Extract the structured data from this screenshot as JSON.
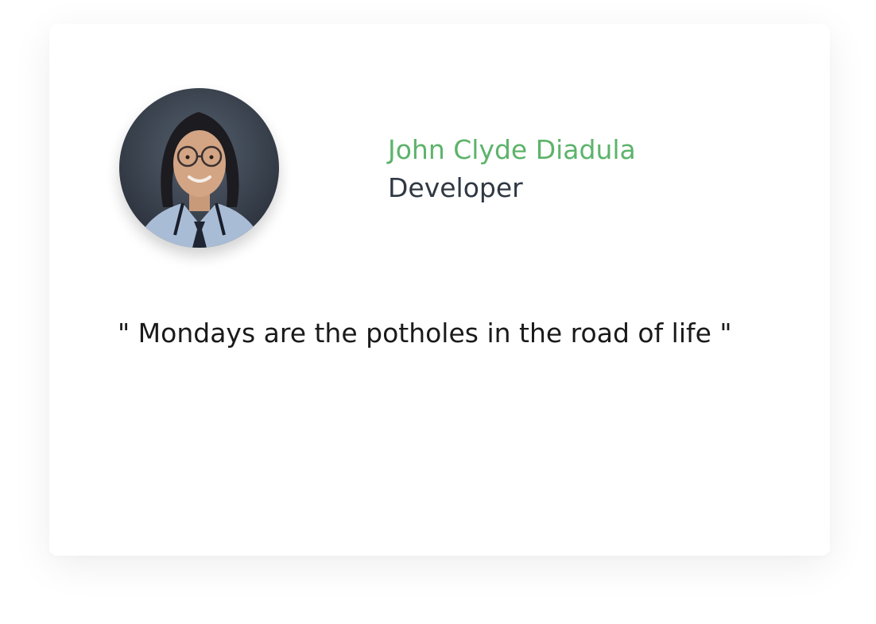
{
  "profile": {
    "name": "John Clyde Diadula",
    "role": "Developer",
    "avatar_icon": "avatar-photo"
  },
  "quote": {
    "text": "\" Mondays are the potholes in the road of life \""
  },
  "colors": {
    "name": "#5db36b",
    "role": "#2f3843",
    "quote": "#1a1a1a",
    "card_background": "#ffffff"
  }
}
